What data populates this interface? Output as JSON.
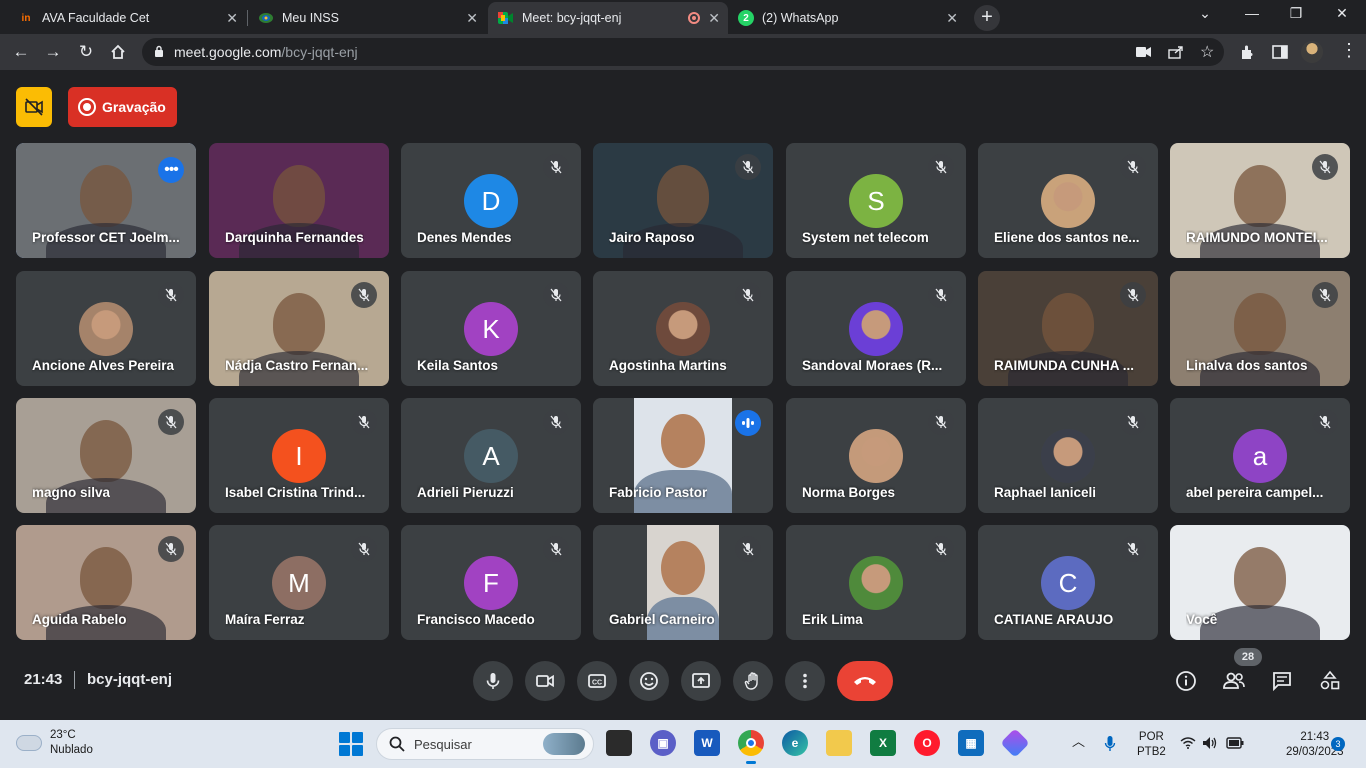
{
  "browser": {
    "tabs": [
      {
        "title": "AVA Faculdade Cet",
        "favicon": "ava-logo-icon",
        "favicon_color": "#ff6f00",
        "active": false
      },
      {
        "title": "Meu INSS",
        "favicon": "inss-logo-icon",
        "favicon_color": "#2e7d32",
        "active": false
      },
      {
        "title": "Meet: bcy-jqqt-enj",
        "favicon": "google-meet-icon",
        "favicon_color": "#00ac47",
        "active": true,
        "recording": true
      },
      {
        "title": "(2) WhatsApp",
        "favicon": "whatsapp-icon",
        "favicon_color": "#25d366",
        "badge": "2",
        "active": false
      }
    ],
    "address": {
      "domain": "meet.google.com",
      "path": "/bcy-jqqt-enj"
    }
  },
  "meet": {
    "recording_label": "Gravação",
    "clock": "21:43",
    "meeting_code": "bcy-jqqt-enj",
    "participant_count": "28",
    "participants": [
      {
        "name": "Professor CET Joelm...",
        "kind": "video",
        "bg": "#6b6f73",
        "selected": true,
        "more": true
      },
      {
        "name": "Darquinha Fernandes",
        "kind": "video",
        "bg": "#5a2a55",
        "muted": false
      },
      {
        "name": "Denes Mendes",
        "kind": "letter",
        "letter": "D",
        "color": "#1e88e5",
        "muted": true
      },
      {
        "name": "Jairo Raposo",
        "kind": "video",
        "bg": "#2b3a44",
        "muted": true
      },
      {
        "name": "System net telecom",
        "kind": "letter",
        "letter": "S",
        "color": "#7cb342",
        "muted": true
      },
      {
        "name": "Eliene dos santos ne...",
        "kind": "photo",
        "photo_bg": "#c9a27a",
        "muted": true
      },
      {
        "name": "RAIMUNDO MONTEI...",
        "kind": "video",
        "bg": "#cfc7b8",
        "muted": true
      },
      {
        "name": "Ancione Alves Pereira",
        "kind": "photo",
        "photo_bg": "#a5836a",
        "muted": true
      },
      {
        "name": "Nádja Castro Fernan...",
        "kind": "video",
        "bg": "#b7a892",
        "muted": true
      },
      {
        "name": "Keila Santos",
        "kind": "letter",
        "letter": "K",
        "color": "#a142c2",
        "muted": true
      },
      {
        "name": "Agostinha Martins",
        "kind": "photo",
        "photo_bg": "#6e4a3c",
        "muted": true
      },
      {
        "name": "Sandoval Moraes (R...",
        "kind": "photo",
        "photo_bg": "#6b3fd6",
        "muted": true
      },
      {
        "name": "RAIMUNDA CUNHA ...",
        "kind": "video",
        "bg": "#4a4038",
        "muted": true
      },
      {
        "name": "Linalva dos santos",
        "kind": "video",
        "bg": "#8d7f70",
        "muted": true
      },
      {
        "name": "magno silva",
        "kind": "video",
        "bg": "#a89f95",
        "muted": true
      },
      {
        "name": "Isabel Cristina Trind...",
        "kind": "letter",
        "letter": "I",
        "color": "#f4511e",
        "muted": true
      },
      {
        "name": "Adrieli Pieruzzi",
        "kind": "letter",
        "letter": "A",
        "color": "#455a64",
        "muted": true
      },
      {
        "name": "Fabricio Pastor",
        "kind": "narrow-video",
        "bg": "#dde3ea",
        "speaking": true
      },
      {
        "name": "Norma Borges",
        "kind": "photo",
        "photo_bg": "#c49a7a",
        "muted": true
      },
      {
        "name": "Raphael Ianiceli",
        "kind": "photo",
        "photo_bg": "#3b3f4a",
        "muted": true
      },
      {
        "name": "abel pereira campel...",
        "kind": "letter",
        "letter": "a",
        "color": "#8e44c5",
        "muted": true
      },
      {
        "name": "Aguida Rabelo",
        "kind": "video",
        "bg": "#b09b8d",
        "muted": true
      },
      {
        "name": "Maíra Ferraz",
        "kind": "letter",
        "letter": "M",
        "color": "#8d6e63",
        "muted": true
      },
      {
        "name": "Francisco Macedo",
        "kind": "letter",
        "letter": "F",
        "color": "#a142c2",
        "muted": true
      },
      {
        "name": "Gabriel Carneiro",
        "kind": "narrow-video",
        "bg": "#d8d4cf",
        "muted": true
      },
      {
        "name": "Erik Lima",
        "kind": "photo",
        "photo_bg": "#4f8a3b",
        "muted": true
      },
      {
        "name": "CATIANE ARAUJO",
        "kind": "letter",
        "letter": "C",
        "color": "#5c6bc0",
        "muted": true
      },
      {
        "name": "Você",
        "kind": "video",
        "bg": "#e9ecef",
        "muted": false
      }
    ]
  },
  "taskbar": {
    "weather_temp": "23°C",
    "weather_desc": "Nublado",
    "search_placeholder": "Pesquisar",
    "lang_1": "POR",
    "lang_2": "PTB2",
    "time": "21:43",
    "date": "29/03/2023",
    "notifications": "3"
  }
}
